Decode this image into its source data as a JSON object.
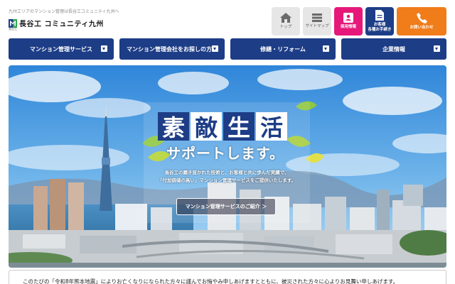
{
  "header": {
    "tagline": "九州エリアのマンション管理は長谷工コミュニティ九州へ",
    "logo_text": "長谷工 コミュニティ九州",
    "logo_sub": "長谷工",
    "buttons": [
      {
        "label": "トップ",
        "icon": "home-icon"
      },
      {
        "label": "サイトマップ",
        "icon": "list-icon"
      },
      {
        "label": "採用情報",
        "icon": "id-card-icon"
      },
      {
        "label": "お客様\n各種お手続き",
        "icon": "document-icon"
      },
      {
        "label": "お問い合わせ",
        "icon": "phone-icon"
      }
    ]
  },
  "nav": {
    "items": [
      {
        "label": "マンション管理サービス"
      },
      {
        "label": "マンション管理会社をお探しの方"
      },
      {
        "label": "修繕・リフォーム"
      },
      {
        "label": "企業情報"
      }
    ]
  },
  "hero": {
    "title_chars": [
      "素",
      "敵",
      "生",
      "活"
    ],
    "subtitle": "サポートします。",
    "desc_line1": "長谷工の磨き抜かれた技術と、お客様と共に歩んだ実績で、",
    "desc_line2": "「付加価値の高い」マンション管理サービスをご提供いたします。",
    "cta_label": "マンション管理サービスのご紹介 ＞"
  },
  "notice": {
    "text": "このたびの「令和8年熊本地震」によりお亡くなりになられた方々に謹んでお悔やみ申しあげますとともに、被災された方々に心よりお見舞い申しあげます。"
  },
  "colors": {
    "navy": "#1d3d86",
    "pink": "#e6197a",
    "orange": "#f07d1a",
    "gray": "#e6e6e6"
  }
}
